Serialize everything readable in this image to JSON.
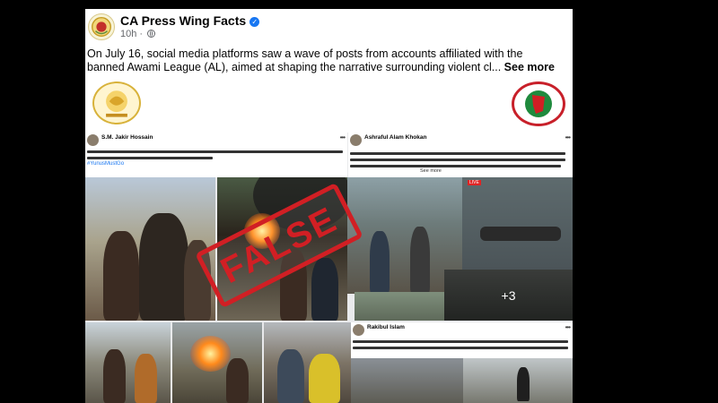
{
  "post": {
    "page_name": "CA Press Wing Facts",
    "timestamp": "10h",
    "dot": "·",
    "verified_glyph": "✓",
    "text": "On July 16, social media platforms saw a wave of posts from accounts affiliated with the banned Awami League (AL), aimed at shaping the narrative surrounding violent cl...",
    "see_more": "See more"
  },
  "image": {
    "stamp": "FALSE",
    "left_post": {
      "author": "S.M. Jakir Hossain",
      "hashtag": "#YunusMustGo"
    },
    "right_post": {
      "author": "Ashraful Alam Khokan",
      "see_more": "See more"
    },
    "bottom_post": {
      "author": "Rakibul Islam"
    },
    "live_label": "LIVE",
    "more_photos": "+3"
  },
  "colors": {
    "verified": "#1877f2",
    "stamp": "#d11f24",
    "background": "#000000"
  },
  "icons": [
    "globe-icon",
    "verified-icon",
    "more-options-icon"
  ]
}
